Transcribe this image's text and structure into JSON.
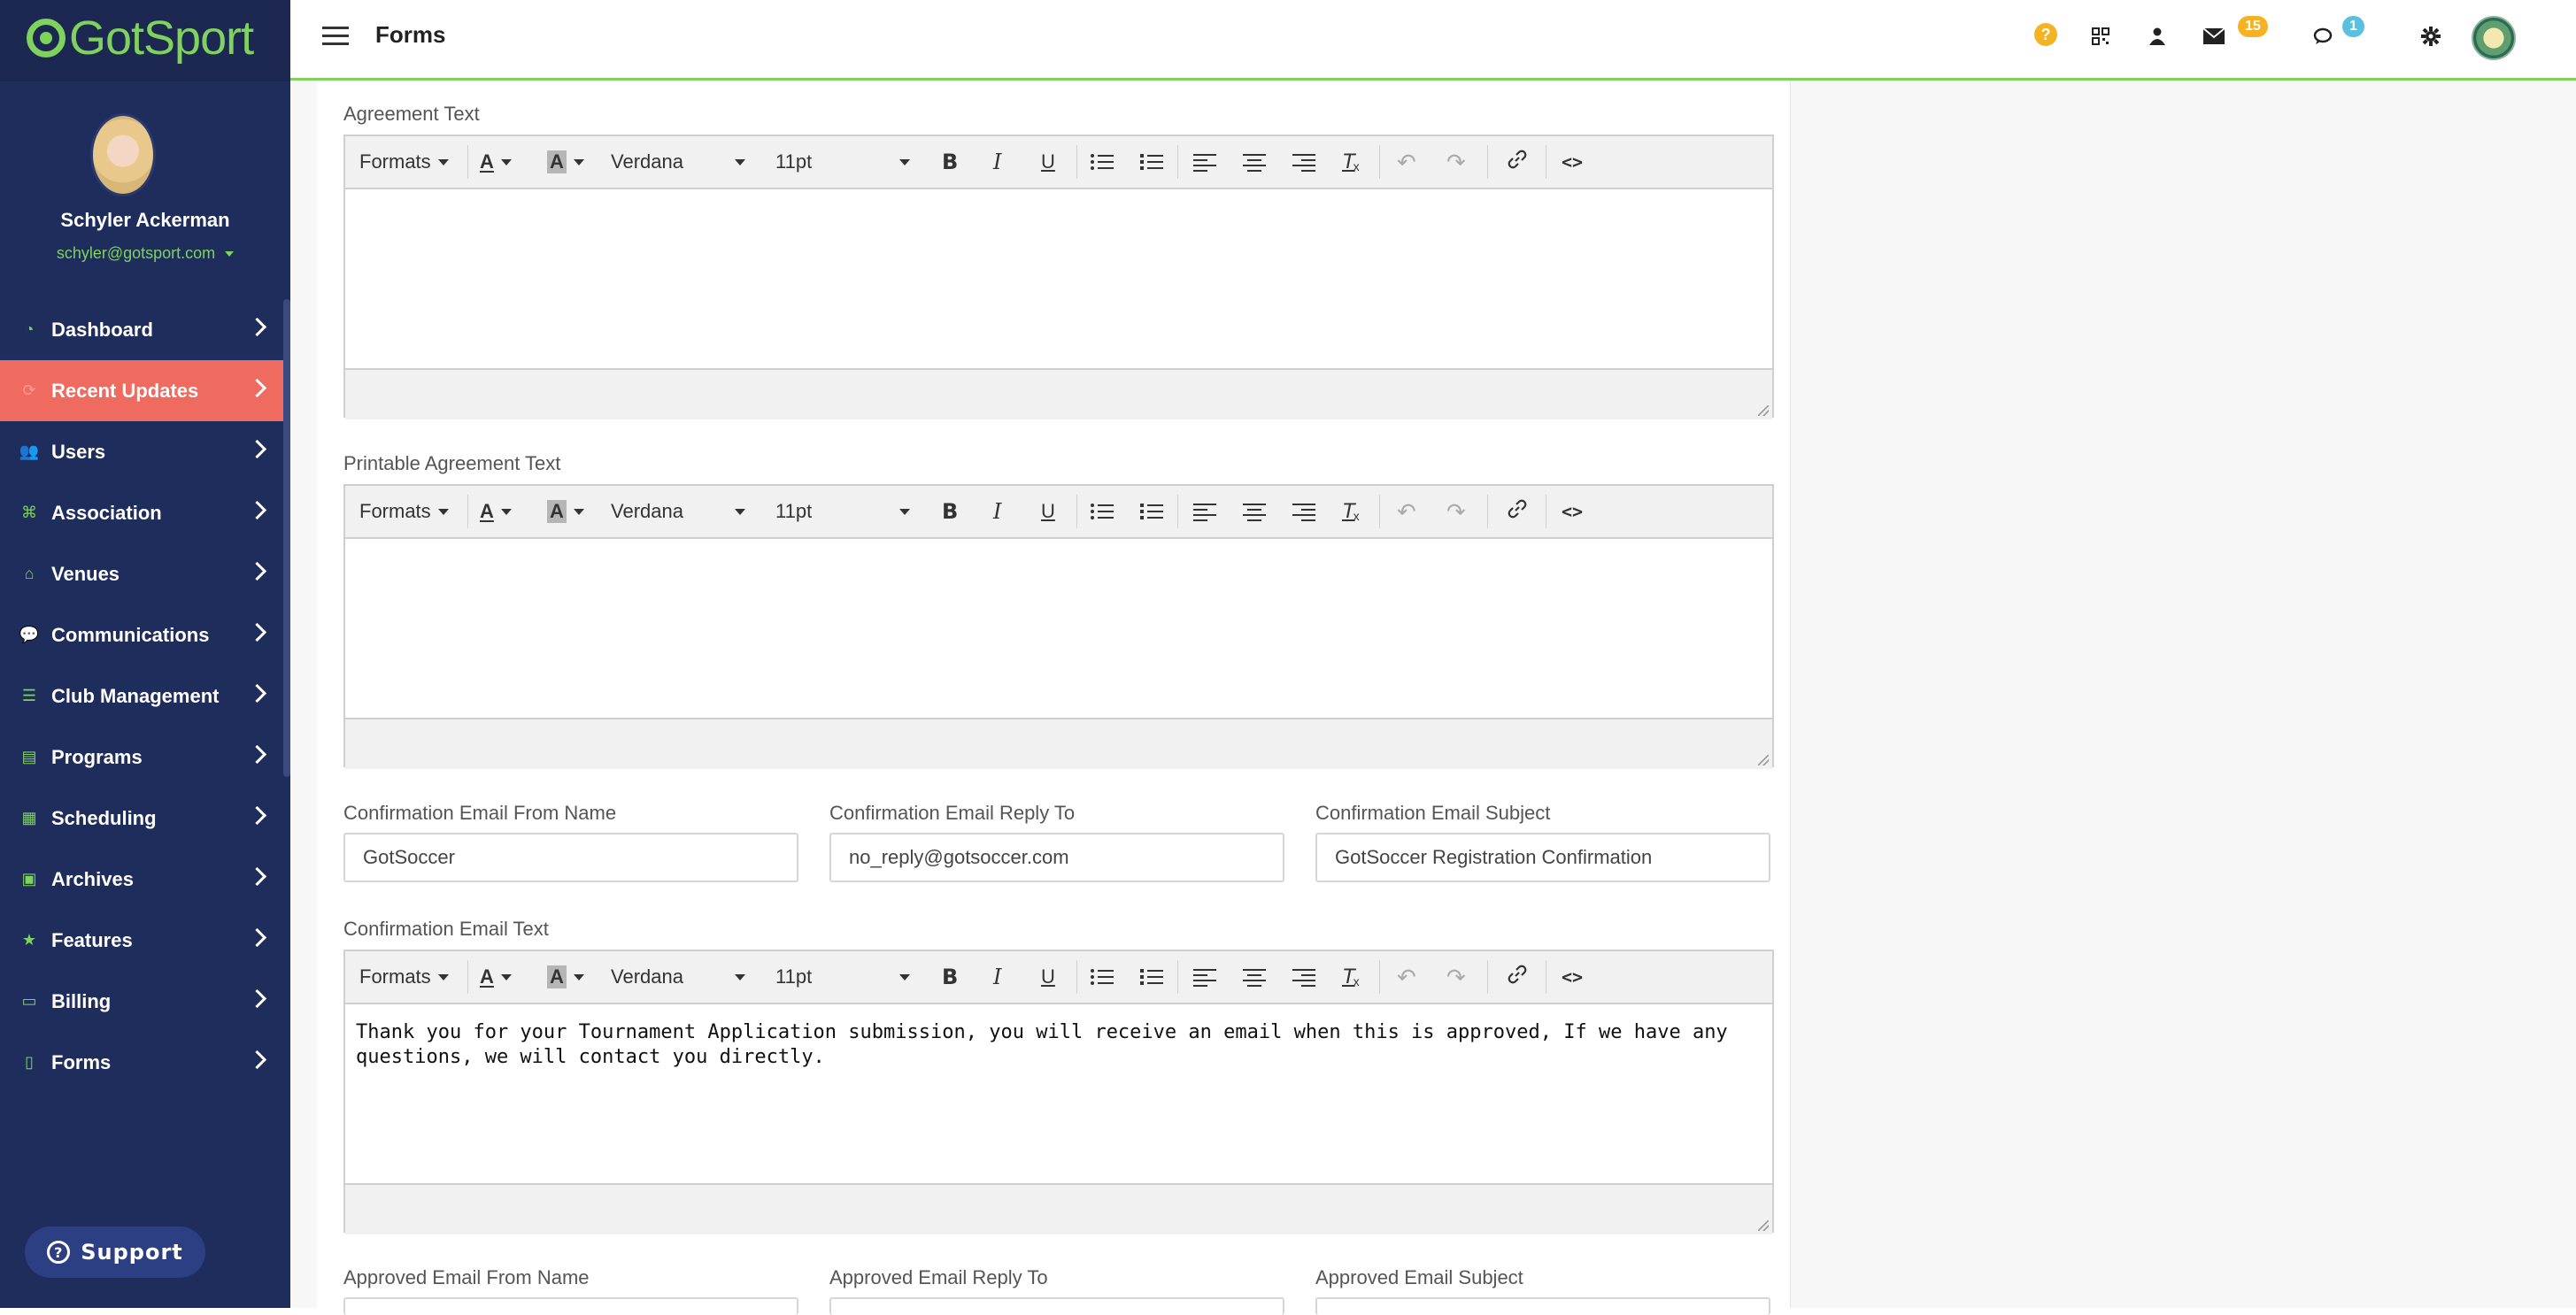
{
  "app": {
    "logo_text": "GotSport",
    "page_title": "Forms"
  },
  "user": {
    "name": "Schyler Ackerman",
    "email": "schyler@gotsport.com"
  },
  "sidebar": {
    "items": [
      {
        "label": "Dashboard",
        "icon": "dashboard-icon",
        "glyph": "◔"
      },
      {
        "label": "Recent Updates",
        "icon": "refresh-icon",
        "glyph": "⟳"
      },
      {
        "label": "Users",
        "icon": "users-icon",
        "glyph": "👥"
      },
      {
        "label": "Association",
        "icon": "sitemap-icon",
        "glyph": "⌘"
      },
      {
        "label": "Venues",
        "icon": "home-icon",
        "glyph": "⌂"
      },
      {
        "label": "Communications",
        "icon": "chat-icon",
        "glyph": "💬"
      },
      {
        "label": "Club Management",
        "icon": "list-icon",
        "glyph": "☰"
      },
      {
        "label": "Programs",
        "icon": "document-icon",
        "glyph": "▤"
      },
      {
        "label": "Scheduling",
        "icon": "calendar-icon",
        "glyph": "▦"
      },
      {
        "label": "Archives",
        "icon": "archive-icon",
        "glyph": "▣"
      },
      {
        "label": "Features",
        "icon": "star-icon",
        "glyph": "★"
      },
      {
        "label": "Billing",
        "icon": "credit-card-icon",
        "glyph": "▭"
      },
      {
        "label": "Forms",
        "icon": "file-icon",
        "glyph": "▯"
      }
    ],
    "active_index": 1,
    "support_label": "Support"
  },
  "topbar": {
    "messages_count": "15",
    "chats_count": "1"
  },
  "toolbar": {
    "formats": "Formats",
    "font": "Verdana",
    "size": "11pt",
    "text_color_glyph": "A",
    "bg_color_glyph": "A",
    "bold": "B",
    "italic": "I",
    "underline": "U",
    "clear": "T",
    "undo": "↶",
    "redo": "↷",
    "link": "🔗",
    "code": "<>"
  },
  "form": {
    "agreement_label": "Agreement Text",
    "printable_label": "Printable Agreement Text",
    "confirm_from_label": "Confirmation Email From Name",
    "confirm_from_value": "GotSoccer",
    "confirm_reply_label": "Confirmation Email Reply To",
    "confirm_reply_value": "no_reply@gotsoccer.com",
    "confirm_subject_label": "Confirmation Email Subject",
    "confirm_subject_value": "GotSoccer Registration Confirmation",
    "confirm_text_label": "Confirmation Email Text",
    "confirm_text_value": "Thank you for your Tournament Application submission, you will receive an email when this is approved, If we have any questions, we will contact you directly.",
    "approved_from_label": "Approved Email From Name",
    "approved_reply_label": "Approved Email Reply To",
    "approved_subject_label": "Approved Email Subject"
  }
}
